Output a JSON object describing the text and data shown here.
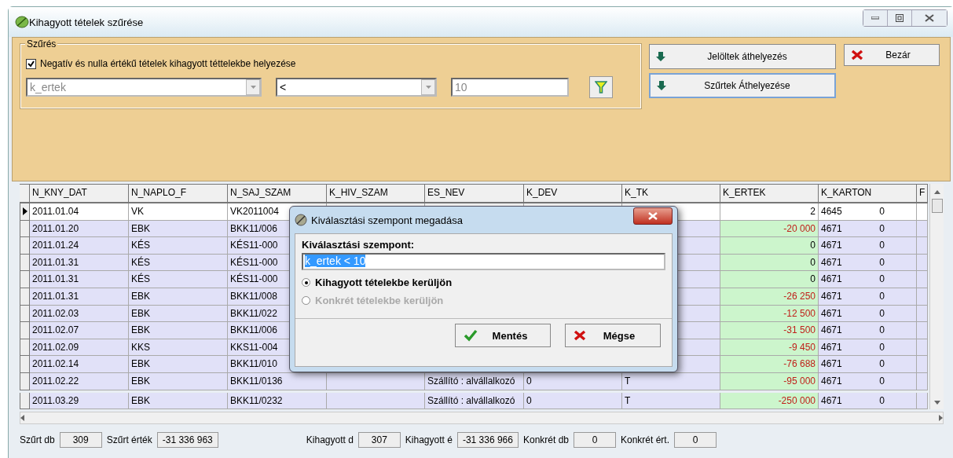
{
  "window": {
    "title": "Kihagyott tételek szűrése"
  },
  "filter": {
    "group_title": "Szűrés",
    "checkbox": {
      "label": "Negatív és nulla értékű tételek kihagyott téttelekbe helyezése",
      "checked": true
    },
    "field_combo": {
      "value": "k_ertek",
      "disabled": true
    },
    "operator_combo": {
      "value": "<"
    },
    "value_field": {
      "value": "10",
      "disabled": true
    }
  },
  "buttons": [
    {
      "kind": "move",
      "label": "Jelöltek áthelyezés",
      "focused": false
    },
    {
      "kind": "move",
      "label": "Szűrtek Áthelyezése",
      "focused": true
    },
    {
      "kind": "close",
      "label": "Bezár"
    }
  ],
  "table": {
    "columns": [
      "N_KNY_DAT",
      "N_NAPLO_F",
      "N_SAJ_SZAM",
      "K_HIV_SZAM",
      "ES_NEV",
      "K_DEV",
      "K_TK",
      "K_ERTEK",
      "K_KARTON",
      "F"
    ],
    "rows": [
      {
        "selected": true,
        "date": "2011.01.04",
        "naplo": "VK",
        "saj_szam": "VK2011004",
        "ertek": "2",
        "negative": false,
        "karton": "4645",
        "karton_2": "0"
      },
      {
        "selected": false,
        "date": "2011.01.20",
        "naplo": "EBK",
        "saj_szam": "BKK11/006",
        "ertek": "-20 000",
        "negative": true,
        "karton": "4671",
        "karton_2": "0"
      },
      {
        "selected": false,
        "date": "2011.01.24",
        "naplo": "KÉS",
        "saj_szam": "KÉS11-000",
        "ertek": "0",
        "negative": false,
        "karton": "4671",
        "karton_2": "0"
      },
      {
        "selected": false,
        "date": "2011.01.31",
        "naplo": "KÉS",
        "saj_szam": "KÉS11-000",
        "ertek": "0",
        "negative": false,
        "karton": "4671",
        "karton_2": "0"
      },
      {
        "selected": false,
        "date": "2011.01.31",
        "naplo": "KÉS",
        "saj_szam": "KÉS11-000",
        "ertek": "0",
        "negative": false,
        "karton": "4671",
        "karton_2": "0"
      },
      {
        "selected": false,
        "date": "2011.01.31",
        "naplo": "EBK",
        "saj_szam": "BKK11/008",
        "ertek": "-26 250",
        "negative": true,
        "karton": "4671",
        "karton_2": "0"
      },
      {
        "selected": false,
        "date": "2011.02.03",
        "naplo": "EBK",
        "saj_szam": "BKK11/022",
        "ertek": "-12 500",
        "negative": true,
        "karton": "4671",
        "karton_2": "0"
      },
      {
        "selected": false,
        "date": "2011.02.07",
        "naplo": "EBK",
        "saj_szam": "BKK11/006",
        "ertek": "-31 500",
        "negative": true,
        "karton": "4671",
        "karton_2": "0"
      },
      {
        "selected": false,
        "date": "2011.02.09",
        "naplo": "KKS",
        "saj_szam": "KKS11-004",
        "ertek": "-9 450",
        "negative": true,
        "karton": "4671",
        "karton_2": "0"
      },
      {
        "selected": false,
        "date": "2011.02.14",
        "naplo": "EBK",
        "saj_szam": "BKK11/010",
        "ertek": "-76 688",
        "negative": true,
        "karton": "4671",
        "karton_2": "0"
      },
      {
        "selected": false,
        "date": "2011.02.22",
        "naplo": "EBK",
        "saj_szam": "BKK11/0136",
        "es_nev": "Szállító : alvállalkozó",
        "dev": "0",
        "tk": "T",
        "ertek": "-95 000",
        "negative": true,
        "karton": "4671",
        "karton_2": "0"
      },
      {
        "selected": false,
        "date": "2011.03.29",
        "naplo": "EBK",
        "saj_szam": "BKK11/0232",
        "es_nev": "Szállító : alvállalkozó",
        "dev": "0",
        "tk": "T",
        "ertek": "-250 000",
        "negative": true,
        "karton": "4671",
        "karton_2": "0"
      }
    ]
  },
  "status_bar": [
    {
      "label": "Szűrt db",
      "value": "309"
    },
    {
      "label": "Szűrt érték",
      "value": "-31 336 963"
    },
    {
      "label": "Kihagyott d",
      "value": "307"
    },
    {
      "label": "Kihagyott é",
      "value": "-31 336 966"
    },
    {
      "label": "Konkrét db",
      "value": "0"
    },
    {
      "label": "Konkrét ért.",
      "value": "0"
    }
  ],
  "dialog": {
    "title": "Kiválasztási szempont megadása",
    "field_label": "Kiválasztási szempont:",
    "field_value": "k_ertek < 10",
    "options": [
      {
        "label": "Kihagyott tételekbe kerüljön",
        "selected": true,
        "disabled": false
      },
      {
        "label": "Konkrét tételekbe kerüljön",
        "selected": false,
        "disabled": true
      }
    ],
    "buttons": [
      {
        "kind": "ok",
        "label": "Mentés"
      },
      {
        "kind": "cancel",
        "label": "Mégse"
      }
    ]
  }
}
